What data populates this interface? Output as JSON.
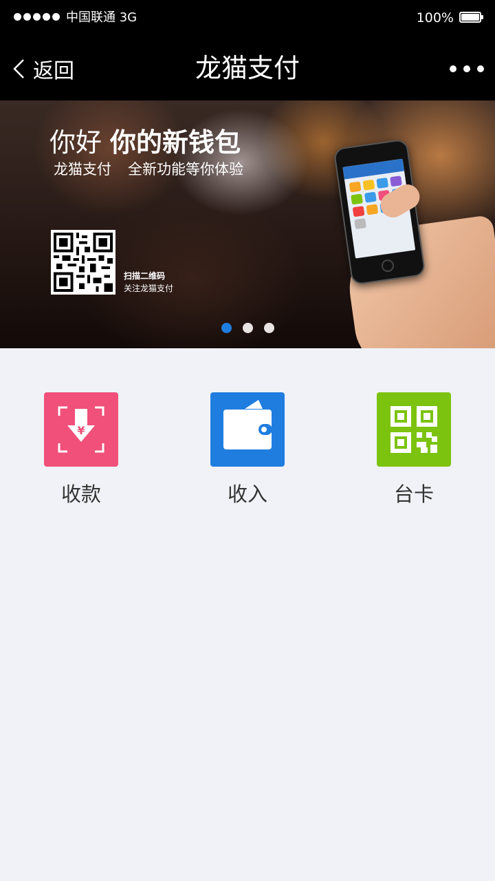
{
  "status_bar": {
    "carrier": "中国联通  3G",
    "battery_percent": "100%",
    "signal_bars": 5,
    "battery_level": 1.0
  },
  "nav": {
    "back_label": "返回",
    "title": "龙猫支付",
    "back_icon": "chevron-left-icon",
    "more_icon": "more-dots-icon"
  },
  "banner": {
    "title_light": "你好",
    "title_bold": "你的新钱包",
    "subtitle_left": "龙猫支付",
    "subtitle_right": "全新功能等你体验",
    "scan_line1": "扫描二维码",
    "scan_line2": "关注龙猫支付",
    "slide_count": 3,
    "active_slide": 1,
    "active_dot_color": "#1f7de0"
  },
  "features": [
    {
      "label": "收款",
      "icon": "receive-payment-icon",
      "color": "#f0507a"
    },
    {
      "label": "收入",
      "icon": "wallet-icon",
      "color": "#1f7de0"
    },
    {
      "label": "台卡",
      "icon": "qr-code-icon",
      "color": "#7cc30f"
    }
  ]
}
